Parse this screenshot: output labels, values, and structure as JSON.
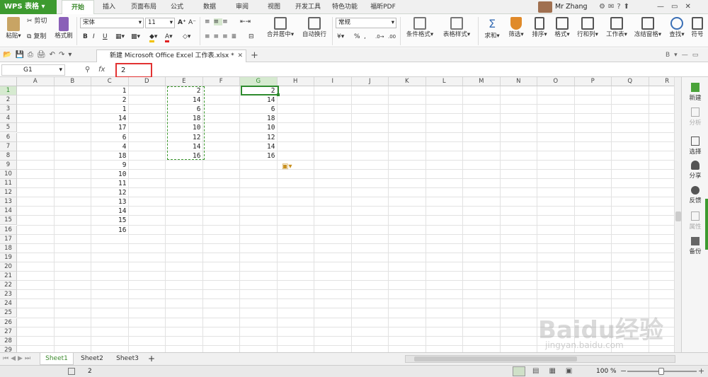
{
  "app": {
    "brand": "WPS 表格",
    "user": "Mr Zhang"
  },
  "menu": [
    "开始",
    "插入",
    "页面布局",
    "公式",
    "数据",
    "审阅",
    "视图",
    "开发工具",
    "特色功能",
    "福昕PDF"
  ],
  "ribbon": {
    "paste": "粘贴",
    "cut": "剪切",
    "copy": "复制",
    "format_painter": "格式刷",
    "font_name": "宋体",
    "font_size": "11",
    "merge_center": "合并居中",
    "wrap_text": "自动换行",
    "number_format": "常规",
    "conditional_format": "条件格式",
    "table_style": "表格样式",
    "sum": "求和",
    "filter": "筛选",
    "sort": "排序",
    "format": "格式",
    "rows_cols": "行和列",
    "worksheet": "工作表",
    "freeze": "冻结窗格",
    "find": "查找",
    "symbol": "符号",
    "percent": "%",
    "comma": ","
  },
  "doc_tab": "新建 Microsoft Office Excel 工作表.xlsx *",
  "name_box": "G1",
  "fx": "fx",
  "formula_value": "2",
  "columns": [
    "A",
    "B",
    "C",
    "D",
    "E",
    "F",
    "G",
    "H",
    "I",
    "J",
    "K",
    "L",
    "M",
    "N",
    "O",
    "P",
    "Q",
    "R"
  ],
  "rows": [
    "1",
    "2",
    "3",
    "4",
    "5",
    "6",
    "7",
    "8",
    "9",
    "10",
    "11",
    "12",
    "13",
    "14",
    "15",
    "16",
    "17",
    "18",
    "19",
    "20",
    "21",
    "22",
    "23",
    "24",
    "25",
    "26",
    "27",
    "28",
    "29"
  ],
  "col_C": [
    "1",
    "2",
    "1",
    "14",
    "17",
    "6",
    "4",
    "18",
    "9",
    "10",
    "11",
    "12",
    "13",
    "14",
    "15",
    "16"
  ],
  "col_E": [
    "2",
    "14",
    "6",
    "18",
    "10",
    "12",
    "14",
    "16"
  ],
  "col_G": [
    "2",
    "14",
    "6",
    "18",
    "10",
    "12",
    "14",
    "16"
  ],
  "sidebar": [
    "新建",
    "分析",
    "选择",
    "分享",
    "反馈",
    "属性",
    "备份"
  ],
  "sheets": [
    "Sheet1",
    "Sheet2",
    "Sheet3"
  ],
  "status": {
    "value": "2",
    "zoom": "100 %"
  },
  "watermark": {
    "brand": "Baidu经验",
    "url": "jingyan.baidu.com"
  },
  "colors": {
    "accent": "#3d9a2f",
    "selection": "#2e8b2e",
    "marquee": "#3d9a2f",
    "highlight": "#e23232"
  }
}
